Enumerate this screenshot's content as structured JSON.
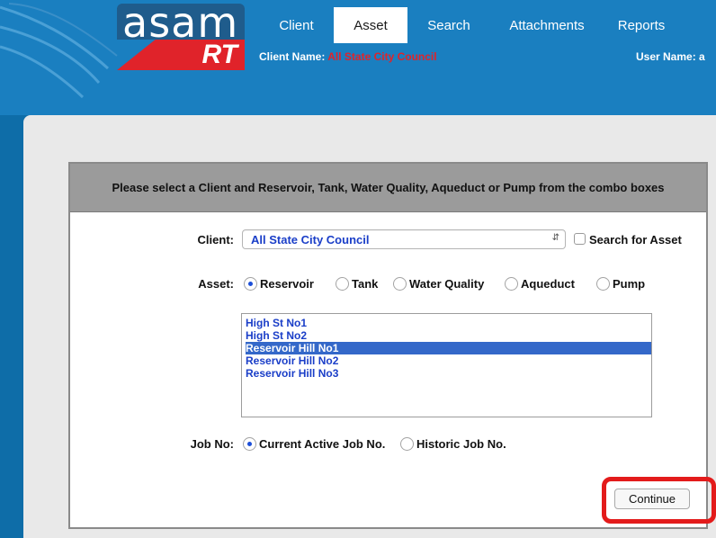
{
  "header": {
    "logo_text": "asam",
    "logo_sub": "RT",
    "tabs": [
      {
        "label": "Client"
      },
      {
        "label": "Asset"
      },
      {
        "label": "Search"
      },
      {
        "label": "Attachments"
      },
      {
        "label": "Reports"
      }
    ],
    "client_name_label": "Client Name:",
    "client_name_value": "All State City Council",
    "user_name_label": "User Name: a"
  },
  "panel": {
    "instruction": "Please select a Client and Reservoir, Tank, Water Quality, Aqueduct or Pump from the combo boxes"
  },
  "form": {
    "client_label": "Client:",
    "client_value": "All State City Council",
    "search_for_asset_label": "Search for Asset",
    "asset_label": "Asset:",
    "asset_options": [
      "Reservoir",
      "Tank",
      "Water Quality",
      "Aqueduct",
      "Pump"
    ],
    "asset_selected": "Reservoir",
    "asset_list": [
      "High St No1",
      "High St No2",
      "Reservoir Hill No1",
      "Reservoir Hill No2",
      "Reservoir Hill No3"
    ],
    "asset_list_selected": "Reservoir Hill No1",
    "job_no_label": "Job No:",
    "job_options": [
      "Current Active Job No.",
      "Historic Job No."
    ],
    "job_selected": "Current Active Job No.",
    "continue_label": "Continue"
  },
  "colors": {
    "header_blue": "#1a7fc0",
    "logo_red": "#e0232a",
    "link_blue": "#1a3ec8",
    "selection_blue": "#3468c9",
    "highlight_red": "#e31b1b"
  }
}
